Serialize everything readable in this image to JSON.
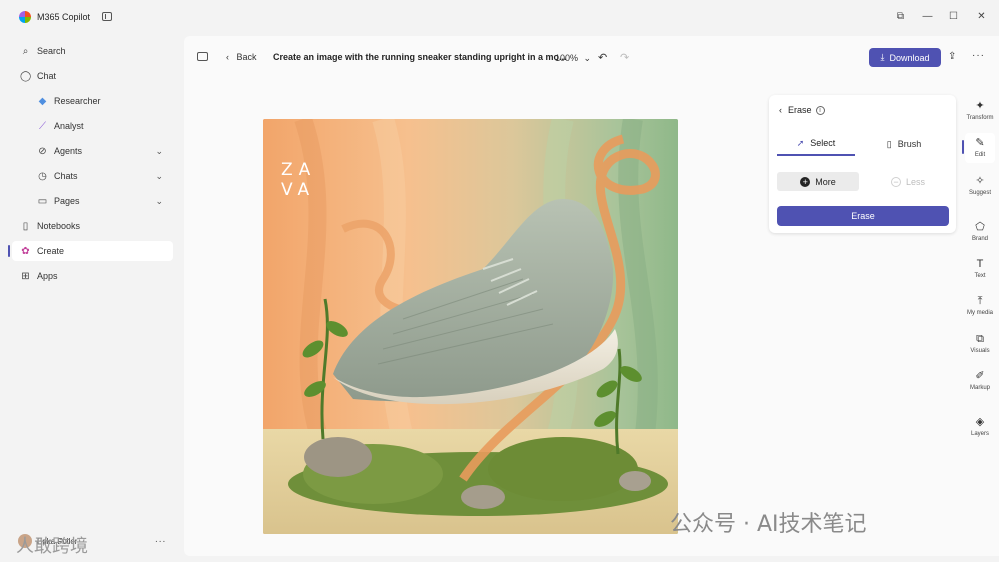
{
  "window": {
    "app_title": "M365 Copilot"
  },
  "sidebar": {
    "items": [
      {
        "label": "Search",
        "icon": "search-icon"
      },
      {
        "label": "Chat",
        "icon": "chat-icon"
      },
      {
        "label": "Researcher",
        "icon": "researcher-icon"
      },
      {
        "label": "Analyst",
        "icon": "analyst-icon"
      },
      {
        "label": "Agents",
        "icon": "agents-icon"
      },
      {
        "label": "Chats",
        "icon": "chats-icon"
      },
      {
        "label": "Pages",
        "icon": "pages-icon"
      },
      {
        "label": "Notebooks",
        "icon": "notebooks-icon"
      },
      {
        "label": "Create",
        "icon": "create-icon"
      },
      {
        "label": "Apps",
        "icon": "apps-icon"
      }
    ],
    "profile_name": "Erika Fuller",
    "more": "..."
  },
  "toolbar": {
    "back_label": "Back",
    "doc_title": "Create an image with the running sneaker standing upright in a mo...",
    "zoom": "100%",
    "download_label": "Download"
  },
  "canvas": {
    "brand_logo_text": "ZAVA"
  },
  "erase_panel": {
    "title": "Erase",
    "tabs": [
      "Select",
      "Brush"
    ],
    "more_label": "More",
    "less_label": "Less",
    "erase_label": "Erase"
  },
  "right_rail": [
    {
      "label": "Transform",
      "icon": "transform-icon"
    },
    {
      "label": "Edit",
      "icon": "edit-icon"
    },
    {
      "label": "Suggest",
      "icon": "suggest-icon"
    },
    {
      "label": "Brand",
      "icon": "brand-icon"
    },
    {
      "label": "Text",
      "icon": "text-icon"
    },
    {
      "label": "My media",
      "icon": "my-media-icon"
    },
    {
      "label": "Visuals",
      "icon": "visuals-icon"
    },
    {
      "label": "Markup",
      "icon": "markup-icon"
    },
    {
      "label": "Layers",
      "icon": "layers-icon"
    }
  ],
  "watermark": {
    "right": "公众号 · AI技术笔记",
    "left": "人敢跨境"
  },
  "colors": {
    "accent": "#4f52b2",
    "background": "#f3f3f3",
    "panel": "#ffffff"
  }
}
